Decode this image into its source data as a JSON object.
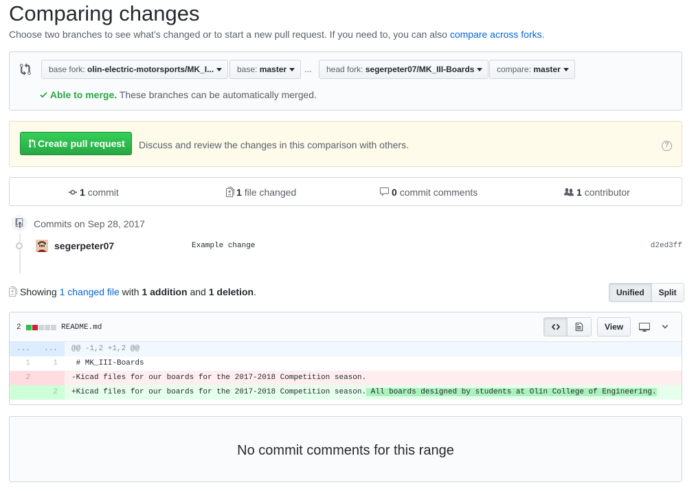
{
  "page": {
    "title": "Comparing changes",
    "subtitle": "Choose two branches to see what’s changed or to start a new pull request. If you need to, you can also",
    "subtitle_link": "compare across forks",
    "subtitle_end": "."
  },
  "range": {
    "base_fork_label": "base fork:",
    "base_fork_value": "olin-electric-motorsports/MK_I...",
    "base_label": "base:",
    "base_value": "master",
    "ellipsis": "...",
    "head_fork_label": "head fork:",
    "head_fork_value": "segerpeter07/MK_III-Boards",
    "compare_label": "compare:",
    "compare_value": "master",
    "merge_ok": "Able to merge.",
    "merge_text": "These branches can be automatically merged."
  },
  "flash": {
    "create_button": "Create pull request",
    "text": "Discuss and review the changes in this comparison with others."
  },
  "stats": {
    "commits_count": "1",
    "commits_label": "commit",
    "files_count": "1",
    "files_label": "file changed",
    "comments_count": "0",
    "comments_label": "commit comments",
    "contributors_count": "1",
    "contributors_label": "contributor"
  },
  "commits": {
    "group_title": "Commits on Sep 28, 2017",
    "items": [
      {
        "author": "segerpeter07",
        "message": "Example change",
        "sha": "d2ed3ff"
      }
    ]
  },
  "diff_summary": {
    "showing": "Showing",
    "changed_files": "1 changed file",
    "with": "with",
    "additions": "1 addition",
    "and": "and",
    "deletions": "1 deletion",
    "end": "."
  },
  "view_toggle": {
    "unified": "Unified",
    "split": "Split"
  },
  "file": {
    "changes": "2",
    "name": "README.md",
    "view_button": "View",
    "rows": [
      {
        "type": "hunk",
        "old": "...",
        "new": "...",
        "code": "@@ -1,2 +1,2 @@"
      },
      {
        "type": "ctx",
        "old": "1",
        "new": "1",
        "code": " # MK_III-Boards"
      },
      {
        "type": "del",
        "old": "2",
        "new": "",
        "code": "-Kicad files for our boards for the 2017-2018 Competition season."
      },
      {
        "type": "add",
        "old": "",
        "new": "2",
        "code": "+Kicad files for our boards for the 2017-2018 Competition season.",
        "highlight": " All boards designed by students at Olin College of Engineering."
      }
    ]
  },
  "no_comments": "No commit comments for this range",
  "colors": {
    "green": "#28a745",
    "link": "#0366d6",
    "del_bg": "#ffeef0",
    "add_bg": "#e6ffed"
  }
}
